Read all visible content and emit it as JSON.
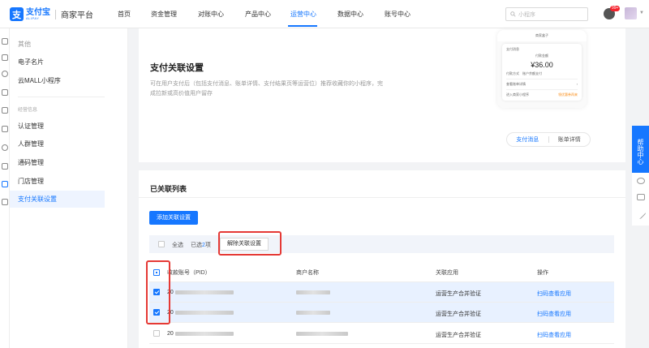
{
  "header": {
    "logo_cn": "支付宝",
    "logo_en": "ALIPAY",
    "platform": "商家平台",
    "nav": [
      "首页",
      "资金管理",
      "对账中心",
      "产品中心",
      "运营中心",
      "数据中心",
      "账号中心"
    ],
    "active_nav": "运营中心",
    "search_placeholder": "小程序",
    "badge": "99+"
  },
  "sidebar": {
    "group1": "其他",
    "items1": [
      "电子名片",
      "云MALL小程序"
    ],
    "group2": "经营信息",
    "items2": [
      "认证管理",
      "人群管理",
      "通码管理",
      "门店管理",
      "支付关联设置"
    ],
    "active": "支付关联设置"
  },
  "intro": {
    "title": "支付关联设置",
    "desc": "可在用户支付后（包括支付消息、账单详情、支付结果页等运营位）推荐收藏你的小程序，完成拉新或高价值用户留存",
    "phone_title": "商家盒子",
    "phone_msg": "支付消息",
    "phone_amount_label": "付款金额",
    "phone_amount": "¥36.00",
    "phone_pay": "付款方式",
    "phone_pay_val": "账户余额支付",
    "phone_row1": "查看账单详情",
    "phone_row2": "进入商家小程序",
    "phone_row2_hint": "领优惠券再来",
    "tabs": [
      "支付消息",
      "账单详情"
    ]
  },
  "list": {
    "title": "已关联列表",
    "add_btn": "添加关联设置",
    "select_all": "全选",
    "selected_prefix": "已选",
    "selected_count": "2",
    "selected_suffix": "项",
    "unlink_btn": "解除关联设置",
    "columns": [
      "收款账号（PID）",
      "商户名称",
      "关联应用",
      "操作"
    ],
    "rows": [
      {
        "pid": "20",
        "app": "运营生产合并验证",
        "action": "扫码查看应用",
        "checked": true
      },
      {
        "pid": "20",
        "app": "运营生产合并验证",
        "action": "扫码查看应用",
        "checked": true
      },
      {
        "pid": "20",
        "app": "运营生产合并验证",
        "action": "扫码查看应用",
        "checked": false
      }
    ]
  },
  "help": {
    "label": "帮助中心"
  }
}
